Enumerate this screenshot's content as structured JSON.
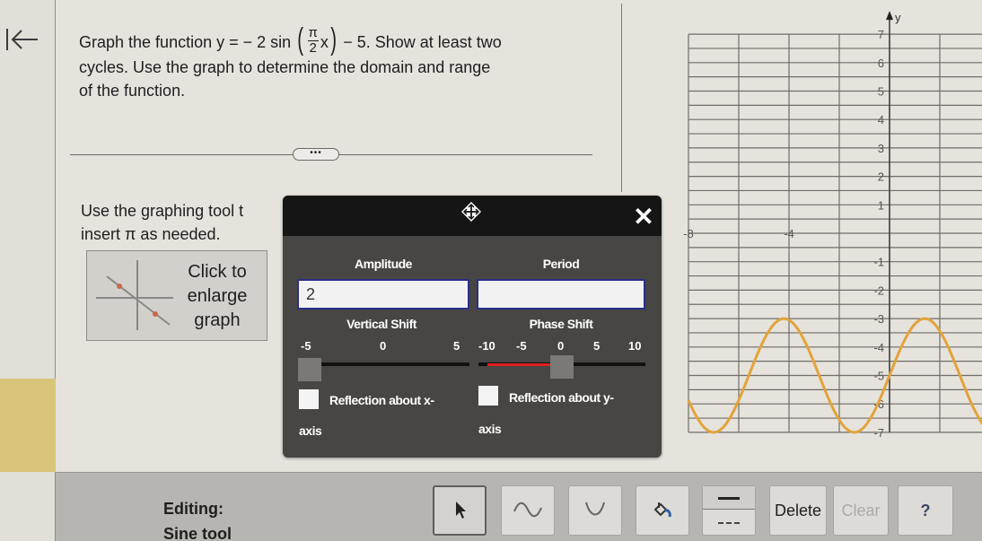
{
  "nav": {
    "back_icon": "back-arrow-icon"
  },
  "question": {
    "part1": "Graph the function y = − 2 sin",
    "frac_num": "π",
    "frac_den": "2",
    "frac_var": "x",
    "part2": "− 5. Show at least two",
    "part3": "cycles. Use the graph to determine the domain and range",
    "part4": "of the function."
  },
  "more_label": "•••",
  "instruction": {
    "line1": "Use the graphing tool t",
    "line2": "insert π as needed."
  },
  "enlarge": {
    "line1": "Click to",
    "line2": "enlarge",
    "line3": "graph"
  },
  "panel": {
    "amplitude_label": "Amplitude",
    "amplitude_value": "2",
    "period_label": "Period",
    "period_value": "",
    "vertical_shift_label": "Vertical Shift",
    "vertical_shift_ticks": [
      "-5",
      "0",
      "5"
    ],
    "vertical_shift_value": -5,
    "phase_shift_label": "Phase Shift",
    "phase_shift_ticks": [
      "-10",
      "-5",
      "0",
      "5",
      "10"
    ],
    "phase_shift_value": -1,
    "reflect_x_label_1": "Reflection about x-",
    "reflect_x_label_2": "axis",
    "reflect_x_checked": false,
    "reflect_y_label_1": "Reflection about y-",
    "reflect_y_label_2": "axis",
    "reflect_y_checked": false,
    "close_label": "✕"
  },
  "graph": {
    "y_axis_label": "y",
    "x_tick_labels": [
      "-8",
      "-4"
    ],
    "y_tick_labels": [
      "7",
      "6",
      "5",
      "4",
      "3",
      "2",
      "1",
      "-1",
      "-2",
      "-3",
      "-4",
      "-5",
      "-6",
      "-7"
    ],
    "curve_color": "#e3a33a",
    "curve": {
      "amplitude": 2,
      "vertical_shift": -5,
      "period": 5.6,
      "rising_zero_at_x": 0
    }
  },
  "toolbar": {
    "editing_label": "Editing:",
    "tool_name": "Sine tool",
    "delete_label": "Delete",
    "clear_label": "Clear",
    "help_label": "?"
  }
}
